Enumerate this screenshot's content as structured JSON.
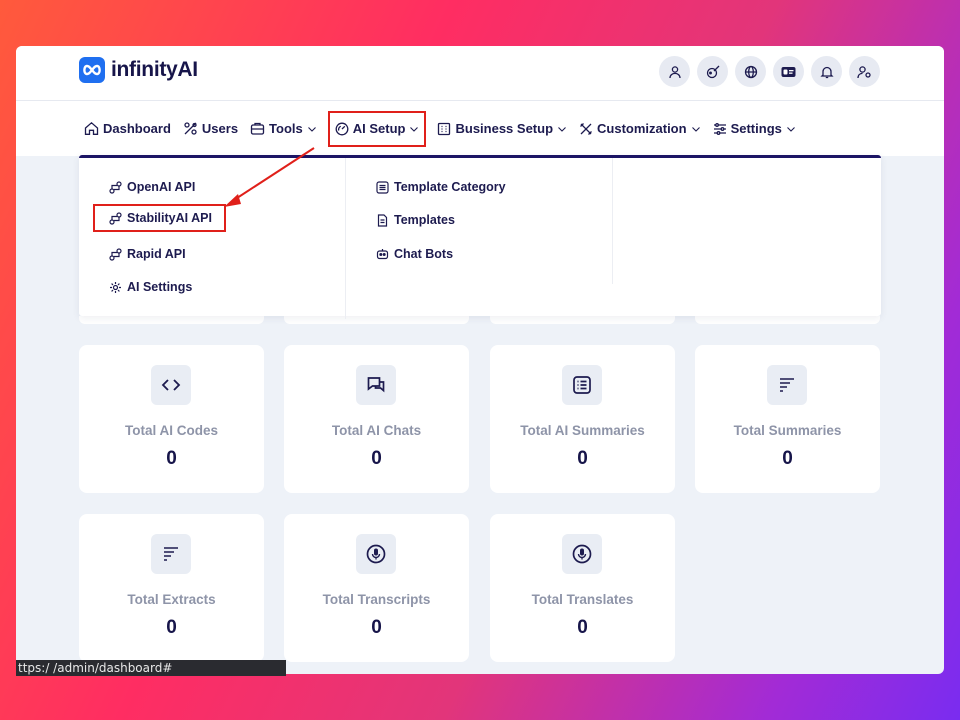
{
  "app": {
    "logo_text": "infinityAI",
    "brand_color": "#1f6ff0"
  },
  "top_icons": [
    "user-icon",
    "brush-icon",
    "globe-icon",
    "id-card-icon",
    "bell-icon",
    "user-settings-icon"
  ],
  "nav": {
    "items": [
      {
        "label": "Dashboard",
        "icon": "home-icon"
      },
      {
        "label": "Users",
        "icon": "users-icon"
      },
      {
        "label": "Tools",
        "icon": "toolbox-icon"
      },
      {
        "label": "AI Setup",
        "icon": "gauge-icon"
      },
      {
        "label": "Business Setup",
        "icon": "building-icon"
      },
      {
        "label": "Customization",
        "icon": "tools-cross-icon"
      },
      {
        "label": "Settings",
        "icon": "sliders-icon"
      }
    ]
  },
  "dropdown": {
    "col1": [
      {
        "label": "OpenAI API",
        "icon": "api-icon"
      },
      {
        "label": "StabilityAI API",
        "icon": "api-icon"
      },
      {
        "label": "Rapid API",
        "icon": "api-icon"
      },
      {
        "label": "AI Settings",
        "icon": "gear-icon"
      }
    ],
    "col2": [
      {
        "label": "Template Category",
        "icon": "list-icon"
      },
      {
        "label": "Templates",
        "icon": "document-icon"
      },
      {
        "label": "Chat Bots",
        "icon": "bot-icon"
      }
    ]
  },
  "cards": [
    {
      "label": "Total AI Codes",
      "value": "0",
      "icon": "code-icon"
    },
    {
      "label": "Total AI Chats",
      "value": "0",
      "icon": "chat-icon"
    },
    {
      "label": "Total AI Summaries",
      "value": "0",
      "icon": "list-icon"
    },
    {
      "label": "Total Summaries",
      "value": "0",
      "icon": "lines-icon"
    },
    {
      "label": "Total Extracts",
      "value": "0",
      "icon": "lines-icon"
    },
    {
      "label": "Total Transcripts",
      "value": "0",
      "icon": "mic-icon"
    },
    {
      "label": "Total Translates",
      "value": "0",
      "icon": "mic-icon"
    }
  ],
  "status_url": "ttps:/              /admin/dashboard#",
  "highlight_color": "#e0201a"
}
